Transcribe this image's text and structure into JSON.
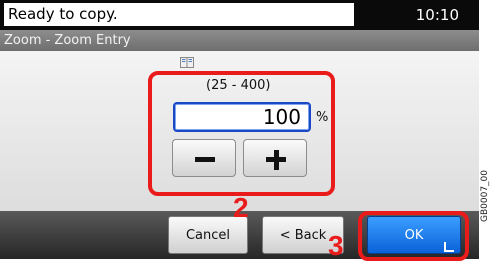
{
  "status": {
    "message": "Ready to copy.",
    "time": "10:10"
  },
  "title": "Zoom - Zoom Entry",
  "zoom": {
    "range": "(25 - 400)",
    "value": "100",
    "unit": "%"
  },
  "buttons": {
    "cancel": "Cancel",
    "back": "< Back",
    "ok": "OK"
  },
  "annotations": {
    "step2": "2",
    "step3": "3"
  },
  "image_code": "GB0007_00",
  "colors": {
    "annotation": "#ea1b1b",
    "ok_button": "#0a62d8",
    "field_border": "#1a49c5"
  },
  "icons": {
    "info": "book-icon",
    "decrement": "minus-icon",
    "increment": "plus-icon",
    "ok": "enter-icon"
  }
}
